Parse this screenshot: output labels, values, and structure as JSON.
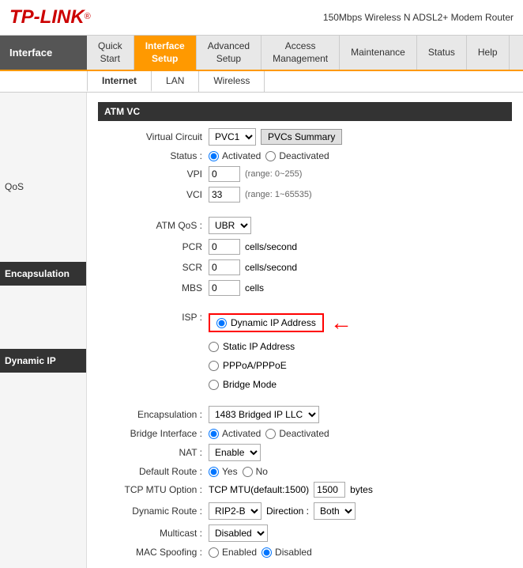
{
  "header": {
    "logo": "TP-LINK",
    "logo_reg": "®",
    "model": "150Mbps Wireless N ADSL2+ Modem Router"
  },
  "nav": {
    "section_title": "Interface",
    "items": [
      {
        "id": "quick-start",
        "label": "Quick\nStart",
        "active": false
      },
      {
        "id": "interface-setup",
        "label": "Interface\nSetup",
        "active": true
      },
      {
        "id": "advanced-setup",
        "label": "Advanced\nSetup",
        "active": false
      },
      {
        "id": "access-management",
        "label": "Access\nManagement",
        "active": false
      },
      {
        "id": "maintenance",
        "label": "Maintenance",
        "active": false
      },
      {
        "id": "status",
        "label": "Status",
        "active": false
      },
      {
        "id": "help",
        "label": "Help",
        "active": false
      }
    ]
  },
  "subnav": {
    "items": [
      {
        "id": "internet",
        "label": "Internet",
        "active": true
      },
      {
        "id": "lan",
        "label": "LAN",
        "active": false
      },
      {
        "id": "wireless",
        "label": "Wireless",
        "active": false
      }
    ]
  },
  "atm_vc": {
    "section": "ATM VC",
    "virtual_circuit_label": "Virtual Circuit",
    "vc_value": "PVC1",
    "pvcs_summary_btn": "PVCs Summary",
    "status_label": "Status",
    "activated": "Activated",
    "deactivated": "Deactivated",
    "vpi_label": "VPI",
    "vpi_value": "0",
    "vpi_range": "(range: 0~255)",
    "vci_label": "VCI",
    "vci_value": "33",
    "vci_range": "(range: 1~65535)"
  },
  "qos": {
    "section": "QoS",
    "atm_qos_label": "ATM QoS",
    "atm_qos_value": "UBR",
    "pcr_label": "PCR",
    "pcr_value": "0",
    "pcr_unit": "cells/second",
    "scr_label": "SCR",
    "scr_value": "0",
    "scr_unit": "cells/second",
    "mbs_label": "MBS",
    "mbs_value": "0",
    "mbs_unit": "cells"
  },
  "encapsulation": {
    "section": "Encapsulation",
    "isp_label": "ISP",
    "isp_options": [
      {
        "id": "dynamic-ip",
        "label": "Dynamic IP Address",
        "selected": true
      },
      {
        "id": "static-ip",
        "label": "Static IP Address",
        "selected": false
      },
      {
        "id": "pppoa-pppoe",
        "label": "PPPoA/PPPoE",
        "selected": false
      },
      {
        "id": "bridge",
        "label": "Bridge Mode",
        "selected": false
      }
    ]
  },
  "dynamic_ip": {
    "section": "Dynamic IP",
    "encapsulation_label": "Encapsulation",
    "encapsulation_value": "1483 Bridged IP LLC",
    "bridge_interface_label": "Bridge Interface",
    "activated": "Activated",
    "deactivated": "Deactivated",
    "nat_label": "NAT",
    "nat_value": "Enable",
    "default_route_label": "Default Route",
    "yes": "Yes",
    "no": "No",
    "tcp_mtu_label": "TCP MTU Option",
    "tcp_mtu_value": "TCP MTU(default:1500)",
    "tcp_mtu_input": "1500",
    "tcp_mtu_unit": "bytes",
    "dynamic_route_label": "Dynamic Route",
    "dynamic_route_value": "RIP2-B",
    "direction_label": "Direction",
    "direction_value": "Both",
    "multicast_label": "Multicast",
    "multicast_value": "Disabled",
    "mac_spoofing_label": "MAC Spoofing",
    "enabled": "Enabled",
    "disabled": "Disabled"
  }
}
